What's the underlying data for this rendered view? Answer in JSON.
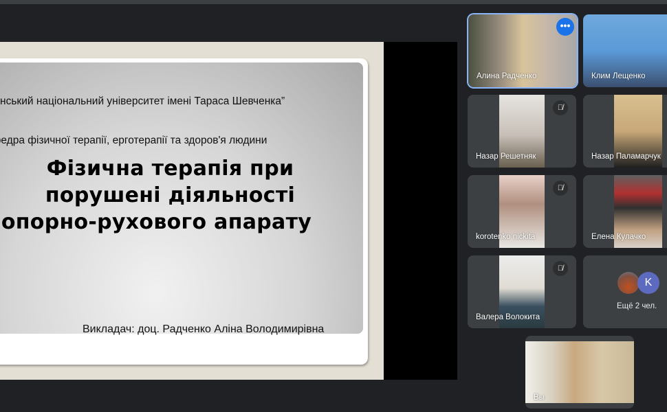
{
  "slide": {
    "university": "Луганський національний університет імені Тараса Шевченка”",
    "department": "Кафедра фізичної терапії, ерготерапії та здоров'я людини",
    "title_line1": "Фізична терапія при",
    "title_line2": "порушені діяльності",
    "title_line3": "опорно-рухового апарату",
    "teacher": "Викладач: доц. Радченко Аліна Володимирівна"
  },
  "participants": [
    {
      "name": "Алина Радченко",
      "muted": false,
      "selected": true
    },
    {
      "name": "Клим Лещенко",
      "muted": false
    },
    {
      "name": "Назар Решетняк",
      "muted": true
    },
    {
      "name": "Назар Паламарчук",
      "muted": false
    },
    {
      "name": "korotenko nickita",
      "muted": true
    },
    {
      "name": "Елена Кулачко",
      "muted": false
    },
    {
      "name": "Валера Волокита",
      "muted": true
    }
  ],
  "more": {
    "label": "Ещё 2 чел.",
    "avatar_letter": "K",
    "avatar_color": "#5c6bc0"
  },
  "self": {
    "name": "Вы"
  },
  "accent": "#1a73e8"
}
